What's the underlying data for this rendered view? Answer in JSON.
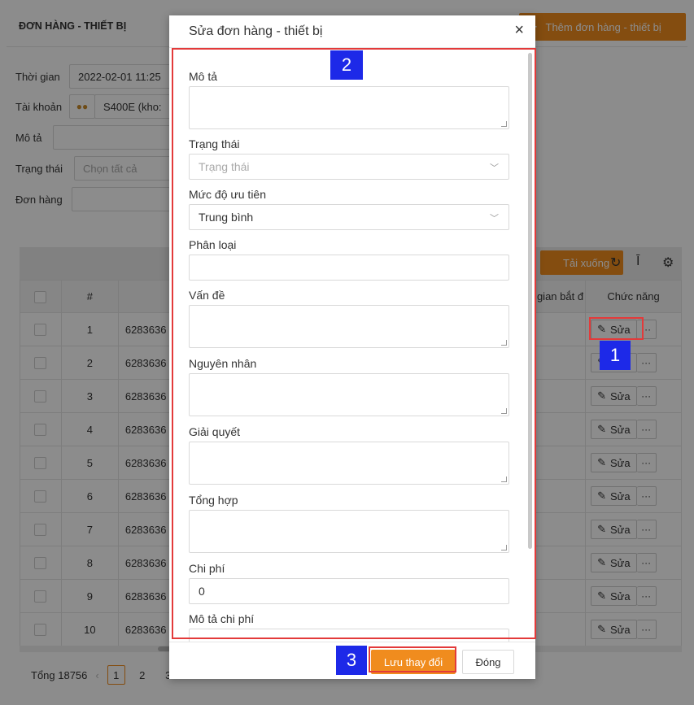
{
  "page": {
    "title": "ĐƠN HÀNG - THIẾT BỊ",
    "add_button": "Thêm đơn hàng - thiết bị",
    "filters": {
      "time_label": "Thời gian",
      "time_value": "2022-02-01 11:25",
      "account_label": "Tài khoản",
      "account_value": "S400E (kho:",
      "desc_label": "Mô tả",
      "status_label": "Trạng thái",
      "status_placeholder": "Chọn tất cả",
      "order_label": "Đơn hàng"
    },
    "toolbar": {
      "download": "Tải xuống"
    },
    "table": {
      "headers": {
        "index": "#",
        "start_time": "gian bắt đ",
        "actions": "Chức năng"
      },
      "edit_label": "Sửa",
      "more_label": "···",
      "rows": [
        {
          "index": "1",
          "code": "6283636"
        },
        {
          "index": "2",
          "code": "6283636"
        },
        {
          "index": "3",
          "code": "6283636"
        },
        {
          "index": "4",
          "code": "6283636"
        },
        {
          "index": "5",
          "code": "6283636"
        },
        {
          "index": "6",
          "code": "6283636"
        },
        {
          "index": "7",
          "code": "6283636"
        },
        {
          "index": "8",
          "code": "6283636"
        },
        {
          "index": "9",
          "code": "6283636"
        },
        {
          "index": "10",
          "code": "6283636"
        }
      ]
    },
    "footer": {
      "total": "Tổng 18756",
      "pages": [
        "1",
        "2",
        "3"
      ]
    }
  },
  "modal": {
    "title": "Sửa đơn hàng - thiết bị",
    "close": "×",
    "fields": {
      "description": "Mô tả",
      "status": "Trạng thái",
      "status_placeholder": "Trạng thái",
      "priority": "Mức độ ưu tiên",
      "priority_value": "Trung bình",
      "category": "Phân loại",
      "issue": "Vấn đề",
      "cause": "Nguyên nhân",
      "solution": "Giải quyết",
      "summary": "Tổng hợp",
      "cost": "Chi phí",
      "cost_value": "0",
      "cost_description": "Mô tả chi phí"
    },
    "save_button": "Lưu thay đổi",
    "close_button": "Đóng"
  },
  "annotations": {
    "badge1": "1",
    "badge2": "2",
    "badge3": "3",
    "color": "#1d29e8",
    "highlight_color": "#e33a3a"
  },
  "colors": {
    "accent": "#f08c1e"
  }
}
